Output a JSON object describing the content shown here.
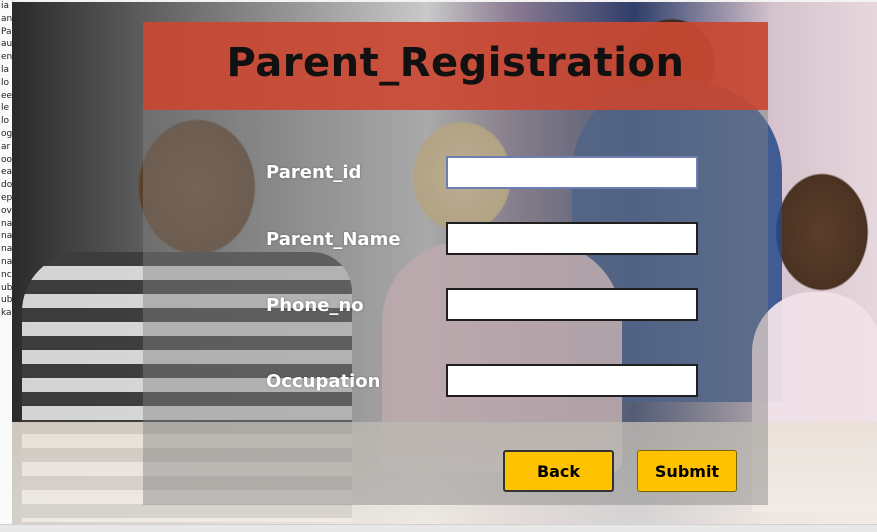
{
  "window": {
    "left_strip_fragments": [
      "ia",
      "an",
      "Pa",
      "au",
      "en",
      "la",
      "lo",
      "ee",
      "le",
      "lo",
      "og",
      "ar",
      "oo",
      "ea",
      "do",
      "ep",
      "ov",
      "na",
      "na",
      "na",
      "na",
      "nc",
      "ub",
      "ub",
      "ka"
    ]
  },
  "form": {
    "title": "Parent_Registration",
    "fields": [
      {
        "label": "Parent_id",
        "value": ""
      },
      {
        "label": "Parent_Name",
        "value": ""
      },
      {
        "label": "Phone_no",
        "value": ""
      },
      {
        "label": "Occupation",
        "value": ""
      }
    ],
    "buttons": {
      "back": "Back",
      "submit": "Submit"
    }
  },
  "colors": {
    "title_bar": "#cd442e",
    "button": "#ffc200"
  }
}
